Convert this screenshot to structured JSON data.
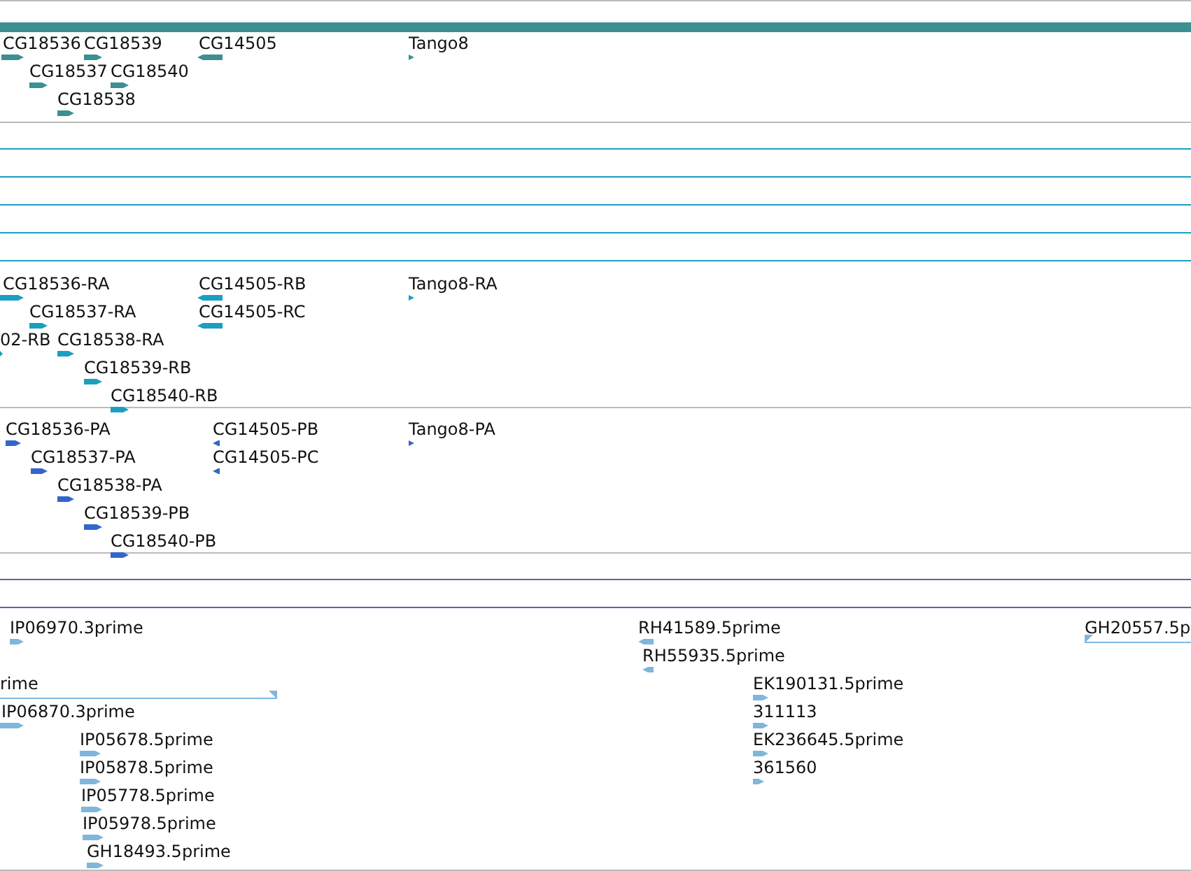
{
  "tracks": [
    {
      "kind": "gene",
      "features": [
        {
          "label": "CG18536",
          "reverse": false
        },
        {
          "label": "CG18539",
          "reverse": false
        },
        {
          "label": "CG14505",
          "reverse": true
        },
        {
          "label": "Tango8",
          "reverse": false
        },
        {
          "label": "CG18537",
          "reverse": false
        },
        {
          "label": "CG18540",
          "reverse": false
        },
        {
          "label": "CG18538",
          "reverse": false
        }
      ]
    },
    {
      "kind": "blank"
    },
    {
      "kind": "blank"
    },
    {
      "kind": "blank"
    },
    {
      "kind": "blank"
    },
    {
      "kind": "blank"
    },
    {
      "kind": "transcript",
      "features": [
        {
          "label": "CG18536-RA",
          "reverse": false
        },
        {
          "label": "CG14505-RB",
          "reverse": true
        },
        {
          "label": "Tango8-RA",
          "reverse": false
        },
        {
          "label": "CG18537-RA",
          "reverse": false
        },
        {
          "label": "CG14505-RC",
          "reverse": true
        },
        {
          "label": "02-RB",
          "reverse": false
        },
        {
          "label": "CG18538-RA",
          "reverse": false
        },
        {
          "label": "CG18539-RB",
          "reverse": false
        },
        {
          "label": "CG18540-RB",
          "reverse": false
        }
      ]
    },
    {
      "kind": "protein",
      "features": [
        {
          "label": "CG18536-PA",
          "reverse": false
        },
        {
          "label": "CG14505-PB",
          "reverse": true
        },
        {
          "label": "Tango8-PA",
          "reverse": false
        },
        {
          "label": "CG18537-PA",
          "reverse": false
        },
        {
          "label": "CG14505-PC",
          "reverse": true
        },
        {
          "label": "CG18538-PA",
          "reverse": false
        },
        {
          "label": "CG18539-PB",
          "reverse": false
        },
        {
          "label": "CG18540-PB",
          "reverse": false
        }
      ]
    },
    {
      "kind": "blank"
    },
    {
      "kind": "blank"
    },
    {
      "kind": "est",
      "features": [
        {
          "label": "IP06970.3prime",
          "reverse": false
        },
        {
          "label": "rime",
          "reverse": true
        },
        {
          "label": "IP06870.3prime",
          "reverse": false
        },
        {
          "label": "IP05678.5prime",
          "reverse": false
        },
        {
          "label": "IP05878.5prime",
          "reverse": false
        },
        {
          "label": "IP05778.5prime",
          "reverse": false
        },
        {
          "label": "IP05978.5prime",
          "reverse": false
        },
        {
          "label": "GH18493.5prime",
          "reverse": false
        },
        {
          "label": "RH41589.5prime",
          "reverse": true
        },
        {
          "label": "RH55935.5prime",
          "reverse": true
        },
        {
          "label": "EK190131.5prime",
          "reverse": false
        },
        {
          "label": "311113",
          "reverse": false
        },
        {
          "label": "EK236645.5prime",
          "reverse": false
        },
        {
          "label": "361560",
          "reverse": false
        },
        {
          "label": "GH20557.5p",
          "reverse": false
        }
      ]
    }
  ]
}
